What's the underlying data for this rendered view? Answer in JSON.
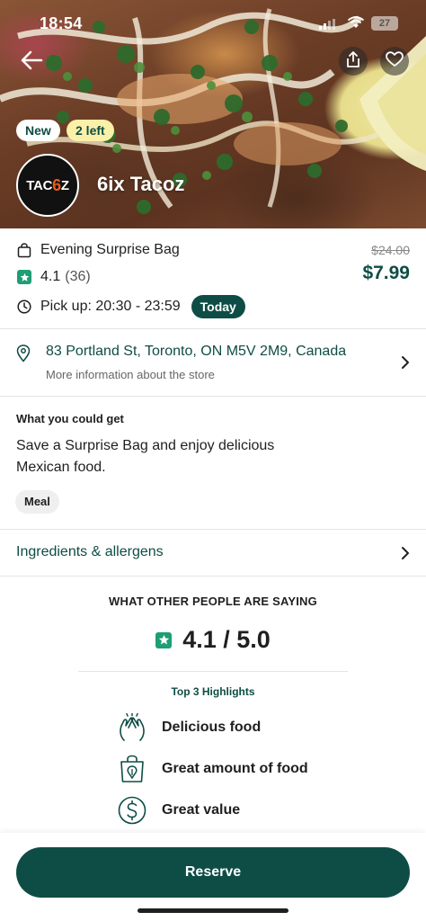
{
  "status_bar": {
    "time": "18:54",
    "battery": "27"
  },
  "hero": {
    "badges": {
      "new": "New",
      "left": "2 left"
    },
    "logo_text_a": "TAC",
    "logo_text_b": "6",
    "logo_text_c": "Z",
    "store_name": "6ix Tacoz"
  },
  "offer": {
    "bag_name": "Evening Surprise Bag",
    "rating": "4.1",
    "rating_count": "(36)",
    "pickup": "Pick up: 20:30 - 23:59",
    "pickup_badge": "Today",
    "original_price": "$24.00",
    "price": "$7.99"
  },
  "address": {
    "line": "83 Portland St, Toronto, ON M5V 2M9, Canada",
    "subtitle": "More information about the store"
  },
  "what_you_get": {
    "heading": "What you could get",
    "description": "Save a Surprise Bag and enjoy delicious Mexican food.",
    "category": "Meal"
  },
  "ingredients": {
    "label": "Ingredients & allergens"
  },
  "reviews": {
    "heading": "WHAT OTHER PEOPLE ARE SAYING",
    "score": "4.1 / 5.0",
    "highlights_title": "Top 3 Highlights",
    "highlights": [
      {
        "label": "Delicious food",
        "icon": "clapping-hands-icon"
      },
      {
        "label": "Great amount of food",
        "icon": "food-bag-icon"
      },
      {
        "label": "Great value",
        "icon": "dollar-icon"
      }
    ]
  },
  "footer": {
    "reserve_label": "Reserve"
  },
  "colors": {
    "brand": "#0e4d45",
    "rating_star": "#1e9e75",
    "badge_left": "#fbf0a8"
  }
}
